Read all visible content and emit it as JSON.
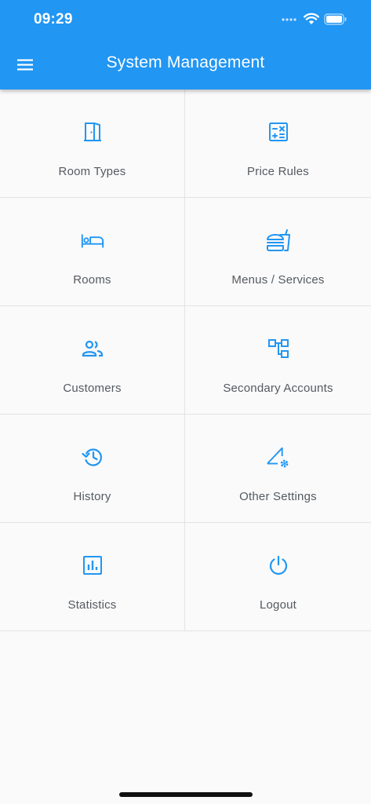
{
  "status_bar": {
    "time": "09:29"
  },
  "app_bar": {
    "title": "System Management",
    "menu_icon": "menu-icon"
  },
  "theme": {
    "primary": "#2196f3",
    "label_color": "#555a60",
    "background": "#fafafa",
    "divider": "#e3e3e3"
  },
  "tiles": [
    {
      "label": "Room Types",
      "icon": "door-icon"
    },
    {
      "label": "Price Rules",
      "icon": "calculator-icon"
    },
    {
      "label": "Rooms",
      "icon": "bed-icon"
    },
    {
      "label": "Menus / Services",
      "icon": "food-icon"
    },
    {
      "label": "Customers",
      "icon": "people-icon"
    },
    {
      "label": "Secondary Accounts",
      "icon": "account-tree-icon"
    },
    {
      "label": "History",
      "icon": "history-icon"
    },
    {
      "label": "Other Settings",
      "icon": "settings-icon"
    },
    {
      "label": "Statistics",
      "icon": "bar-chart-icon"
    },
    {
      "label": "Logout",
      "icon": "power-icon"
    }
  ]
}
